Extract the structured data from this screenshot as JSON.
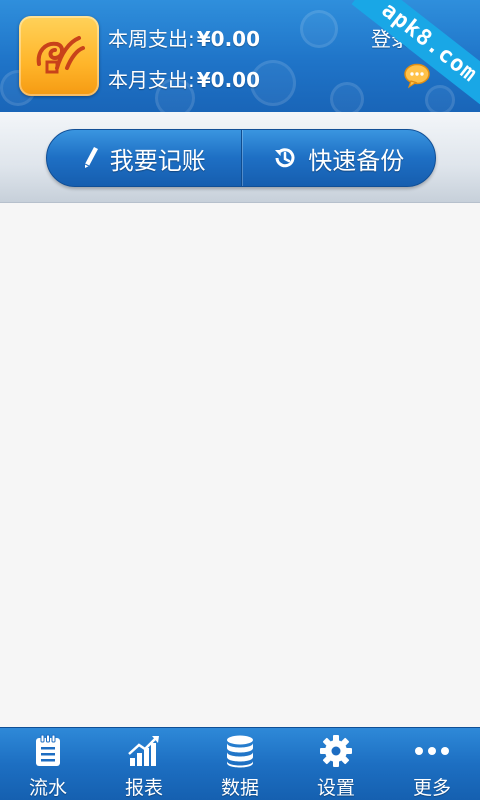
{
  "header": {
    "week_label": "本周支出:",
    "week_amount": "¥0.00",
    "month_label": "本月支出:",
    "month_amount": "¥0.00",
    "login_label": "登录",
    "chat_icon": "chat-bubble-icon",
    "logo_icon": "app-logo-icon",
    "watermark": "apk8.com"
  },
  "actions": {
    "record_label": "我要记账",
    "record_icon": "pencil-icon",
    "backup_label": "快速备份",
    "backup_icon": "history-icon"
  },
  "bottom_nav": {
    "items": [
      {
        "label": "流水",
        "icon": "notepad-icon"
      },
      {
        "label": "报表",
        "icon": "bar-chart-icon"
      },
      {
        "label": "数据",
        "icon": "database-icon"
      },
      {
        "label": "设置",
        "icon": "gear-icon"
      },
      {
        "label": "更多",
        "icon": "more-dots-icon"
      }
    ]
  },
  "colors": {
    "header_blue": "#1f74c8",
    "logo_orange": "#ffb52a",
    "accent_blue": "#19a7e6"
  }
}
